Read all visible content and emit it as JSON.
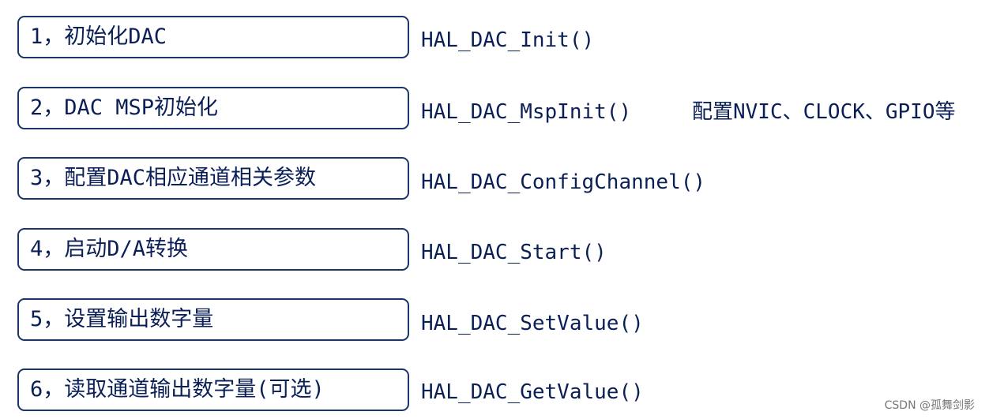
{
  "steps": [
    {
      "label": "1，初始化DAC",
      "function": "HAL_DAC_Init()"
    },
    {
      "label": "2，DAC MSP初始化",
      "function": "HAL_DAC_MspInit()",
      "note": "配置NVIC、CLOCK、GPIO等"
    },
    {
      "label": "3，配置DAC相应通道相关参数",
      "function": "HAL_DAC_ConfigChannel()"
    },
    {
      "label": "4，启动D/A转换",
      "function": "HAL_DAC_Start()"
    },
    {
      "label": "5，设置输出数字量",
      "function": "HAL_DAC_SetValue()"
    },
    {
      "label": "6，读取通道输出数字量(可选)",
      "function": "HAL_DAC_GetValue()"
    }
  ],
  "watermark": "CSDN @孤舞剑影"
}
